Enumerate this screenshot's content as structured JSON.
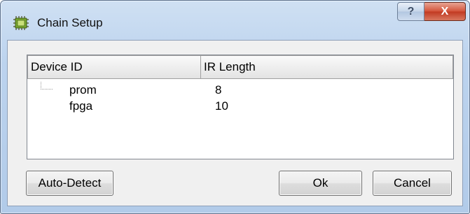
{
  "window": {
    "title": "Chain Setup",
    "icon": "chip-icon",
    "help_label": "?",
    "close_label": "X"
  },
  "list": {
    "columns": [
      "Device ID",
      "IR Length"
    ],
    "rows": [
      {
        "device_id": "prom",
        "ir_length": "8"
      },
      {
        "device_id": "fpga",
        "ir_length": "10"
      }
    ]
  },
  "buttons": {
    "auto_detect": "Auto-Detect",
    "ok": "Ok",
    "cancel": "Cancel"
  },
  "colors": {
    "titlebar": "#bcd3ee",
    "close_button": "#c23a22",
    "client_background": "#f0f0f0"
  }
}
